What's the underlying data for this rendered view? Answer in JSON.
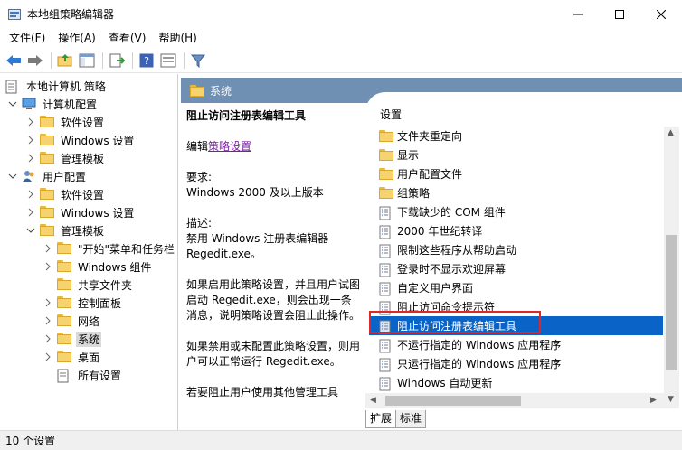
{
  "window": {
    "title": "本地组策略编辑器",
    "controls": [
      "—",
      "☐",
      "✕"
    ]
  },
  "menu": {
    "items": [
      "文件(F)",
      "操作(A)",
      "查看(V)",
      "帮助(H)"
    ]
  },
  "tree": {
    "root": "本地计算机 策略",
    "computer_config": "计算机配置",
    "cc_software": "软件设置",
    "cc_windows": "Windows 设置",
    "cc_admin": "管理模板",
    "user_config": "用户配置",
    "uc_software": "软件设置",
    "uc_windows": "Windows 设置",
    "uc_admin": "管理模板",
    "start_menu": "\"开始\"菜单和任务栏",
    "win_components": "Windows 组件",
    "shared_folders": "共享文件夹",
    "control_panel": "控制面板",
    "network": "网络",
    "system": "系统",
    "desktop": "桌面",
    "all_settings": "所有设置"
  },
  "header": {
    "title": "系统"
  },
  "description": {
    "title": "阻止访问注册表编辑工具",
    "edit_prefix": "编辑",
    "edit_link": "策略设置",
    "req_label": "要求:",
    "req_value": "Windows 2000 及以上版本",
    "desc_label": "描述:",
    "desc_value": "禁用 Windows 注册表编辑器 Regedit.exe。",
    "para1": "如果启用此策略设置，并且用户试图启动 Regedit.exe，则会出现一条消息，说明策略设置会阻止此操作。",
    "para2": "如果禁用或未配置此策略设置，则用户可以正常运行 Regedit.exe。",
    "para3": "若要阻止用户使用其他管理工具"
  },
  "list": {
    "column_header": "设置",
    "items": [
      {
        "label": "文件夹重定向",
        "type": "folder"
      },
      {
        "label": "显示",
        "type": "folder"
      },
      {
        "label": "用户配置文件",
        "type": "folder"
      },
      {
        "label": "组策略",
        "type": "folder"
      },
      {
        "label": "下载缺少的 COM 组件",
        "type": "policy"
      },
      {
        "label": "2000 年世纪转译",
        "type": "policy"
      },
      {
        "label": "限制这些程序从帮助启动",
        "type": "policy"
      },
      {
        "label": "登录时不显示欢迎屏幕",
        "type": "policy"
      },
      {
        "label": "自定义用户界面",
        "type": "policy"
      },
      {
        "label": "阻止访问命令提示符",
        "type": "policy"
      },
      {
        "label": "阻止访问注册表编辑工具",
        "type": "policy"
      },
      {
        "label": "不运行指定的 Windows 应用程序",
        "type": "policy"
      },
      {
        "label": "只运行指定的 Windows 应用程序",
        "type": "policy"
      },
      {
        "label": "Windows 自动更新",
        "type": "policy"
      }
    ]
  },
  "tabs": {
    "extended": "扩展",
    "standard": "标准"
  },
  "status": {
    "text": "10 个设置"
  },
  "colors": {
    "header_band": "#6f8fb3",
    "selection": "#0a64c8",
    "highlight_border": "#e0262a"
  }
}
